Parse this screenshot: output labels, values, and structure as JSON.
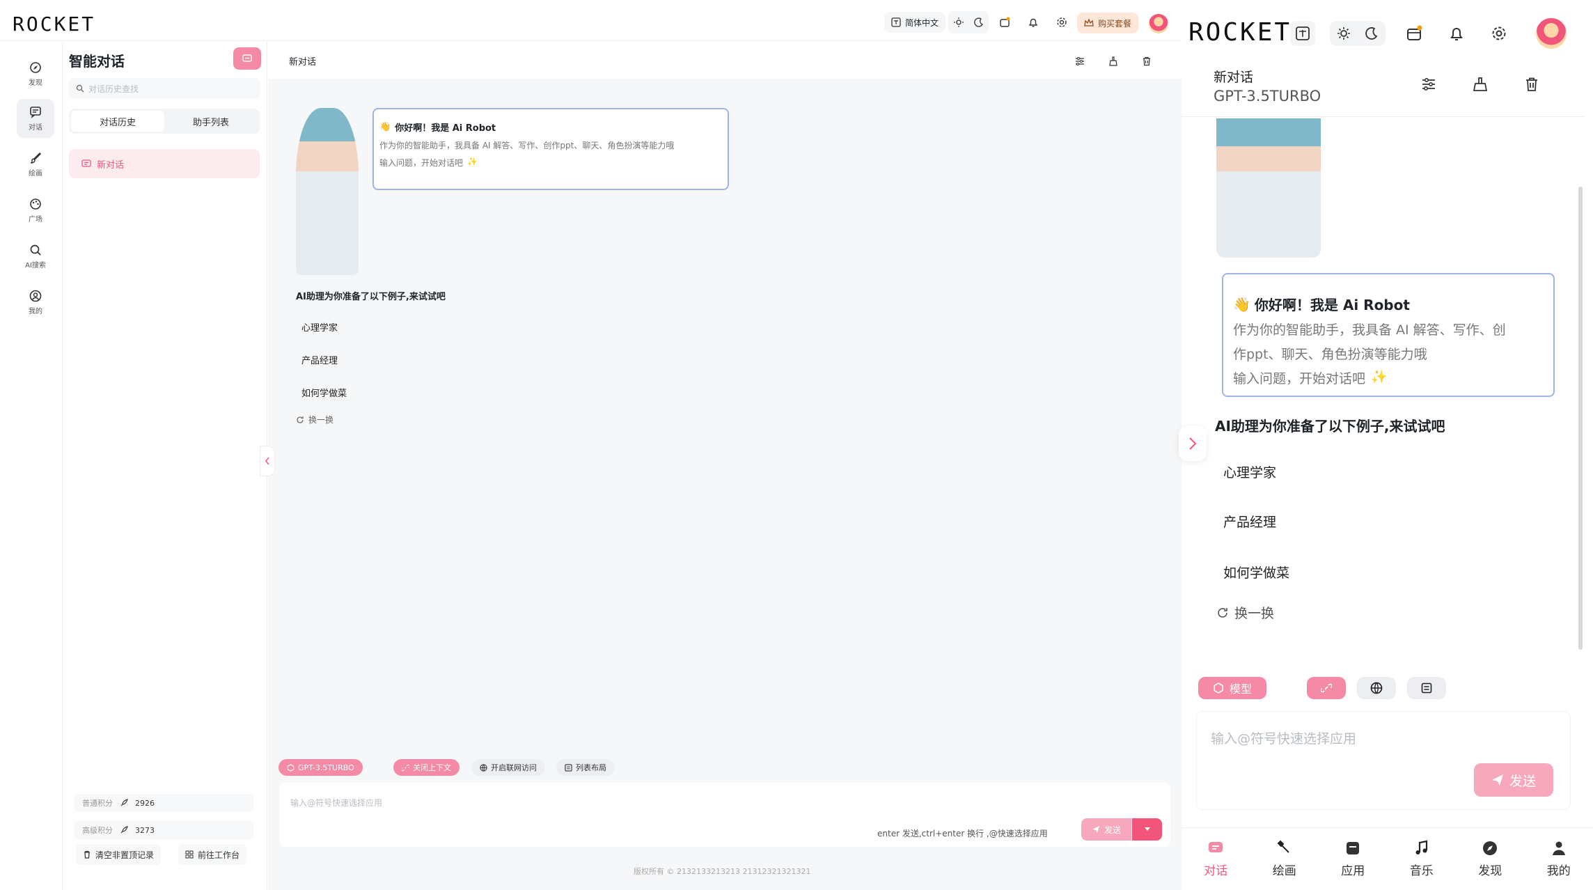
{
  "brand": {
    "logo": "ROCKET"
  },
  "topbar": {
    "lang_label": "简体中文",
    "buy_label": "购买套餐"
  },
  "rail": {
    "items": [
      {
        "label": "发现",
        "icon": "compass-icon"
      },
      {
        "label": "对话",
        "icon": "chat-icon"
      },
      {
        "label": "绘画",
        "icon": "brush-icon"
      },
      {
        "label": "广场",
        "icon": "palette-icon"
      },
      {
        "label": "AI搜索",
        "icon": "search-icon"
      },
      {
        "label": "我的",
        "icon": "user-icon"
      }
    ]
  },
  "sidebar": {
    "title": "智能对话",
    "search_placeholder": "对话历史查找",
    "tabs": [
      "对话历史",
      "助手列表"
    ],
    "conversation": "新对话",
    "points": [
      {
        "label": "普通积分",
        "value": "2926"
      },
      {
        "label": "高级积分",
        "value": "3273"
      }
    ],
    "clear_button": "清空非置顶记录",
    "workspace_button": "前往工作台"
  },
  "main": {
    "title": "新对话",
    "greeting_title": "你好啊！我是 Ai Robot",
    "greeting_text_1": "作为你的智能助手，我具备 AI 解答、写作、创作ppt、聊天、角色扮演等能力哦",
    "greeting_text_2": "输入问题，开始对话吧",
    "examples_heading": "AI助理为你准备了以下例子,来试试吧",
    "examples": [
      "心理学家",
      "产品经理",
      "如何学做菜"
    ],
    "refresh_label": "换一换",
    "chips": [
      "GPT-3.5TURBO",
      "关闭上下文",
      "开启联网访问",
      "列表布局"
    ],
    "input_placeholder": "输入@符号快速选择应用",
    "hint": "enter 发送,ctrl+enter 换行 ,@快速选择应用",
    "send_label": "发送",
    "copyright": "版权所有 © 2132133213213  21312321321321"
  },
  "mobile": {
    "title": "新对话",
    "model": "GPT-3.5TURBO",
    "greeting_title": "你好啊！我是 Ai Robot",
    "greeting_text_1": "作为你的智能助手，我具备 AI 解答、写作、创",
    "greeting_text_2": "作ppt、聊天、角色扮演等能力哦",
    "greeting_text_3": "输入问题，开始对话吧",
    "examples_heading": "AI助理为你准备了以下例子,来试试吧",
    "examples": [
      "心理学家",
      "产品经理",
      "如何学做菜"
    ],
    "refresh_label": "换一换",
    "model_chip": "模型",
    "input_placeholder": "输入@符号快速选择应用",
    "send_label": "发送",
    "tabs": [
      "对话",
      "绘画",
      "应用",
      "音乐",
      "发现",
      "我的"
    ]
  },
  "colors": {
    "accent": "#f2557a",
    "accent_light": "#f58aa6",
    "bubble_border": "#9fb3e6"
  }
}
